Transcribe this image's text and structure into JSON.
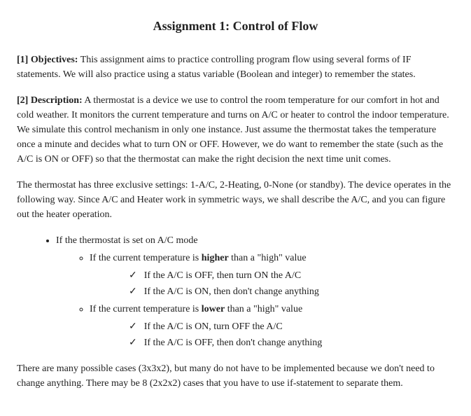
{
  "title": "Assignment 1: Control of Flow",
  "section1": {
    "label": "[1] Objectives:",
    "text": " This assignment aims to practice controlling program flow using several forms of IF statements. We will also practice using a status variable (Boolean and integer) to remember the states."
  },
  "section2": {
    "label": "[2] Description:",
    "text": " A thermostat is a device we use to control the room temperature for our comfort in hot and cold weather. It monitors the current temperature and turns on A/C or heater to control the indoor temperature. We simulate this control mechanism in only one instance. Just assume the thermostat takes the temperature once a minute and decides what to turn ON or OFF. However, we do want to remember the state (such as the A/C is ON or OFF) so that the thermostat can make the right decision the next time unit comes."
  },
  "para3": "The thermostat has three exclusive settings: 1-A/C, 2-Heating, 0-None (or standby). The device operates in the following way. Since A/C and Heater work in symmetric ways, we shall describe the A/C, and you can figure out the heater operation.",
  "bullet1": "If the thermostat is set on A/C mode",
  "sub1": {
    "pre": "If the current temperature is ",
    "bold": "higher",
    "post": " than a \"high\" value"
  },
  "check1a": "If the A/C is OFF, then turn ON the A/C",
  "check1b": "If the A/C is ON, then don't change anything",
  "sub2": {
    "pre": "If the current temperature is ",
    "bold": "lower",
    "post": " than a \"high\" value"
  },
  "check2a": "If the A/C is ON, turn OFF the A/C",
  "check2b": "If the A/C is OFF, then don't change anything",
  "para4": "There are many possible cases (3x3x2), but many do not have to be implemented because we don't need to change anything. There may be 8 (2x2x2) cases that you have to use if-statement to separate them."
}
